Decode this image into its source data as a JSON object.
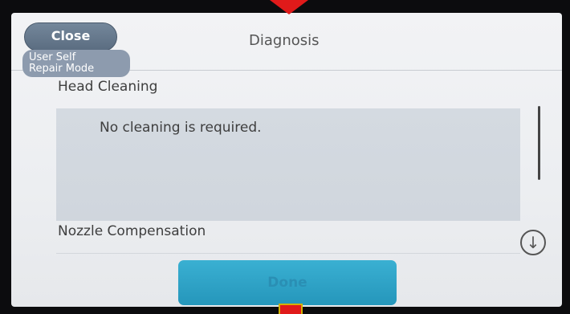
{
  "header": {
    "title": "Diagnosis",
    "close_label": "Close",
    "mode_badge": [
      "User Self",
      "Repair Mode"
    ]
  },
  "sections": [
    {
      "label": "Head Cleaning",
      "message": "No cleaning is required."
    },
    {
      "label": "Nozzle Compensation"
    }
  ],
  "footer": {
    "done_label": "Done"
  },
  "icons": {
    "scroll_down": "arrow-down-circle-icon"
  },
  "colors": {
    "done_button": "#2ea3c8",
    "close_button": "#667a8f",
    "message_panel": "#d2d8df",
    "marker": "#e01a1a"
  }
}
